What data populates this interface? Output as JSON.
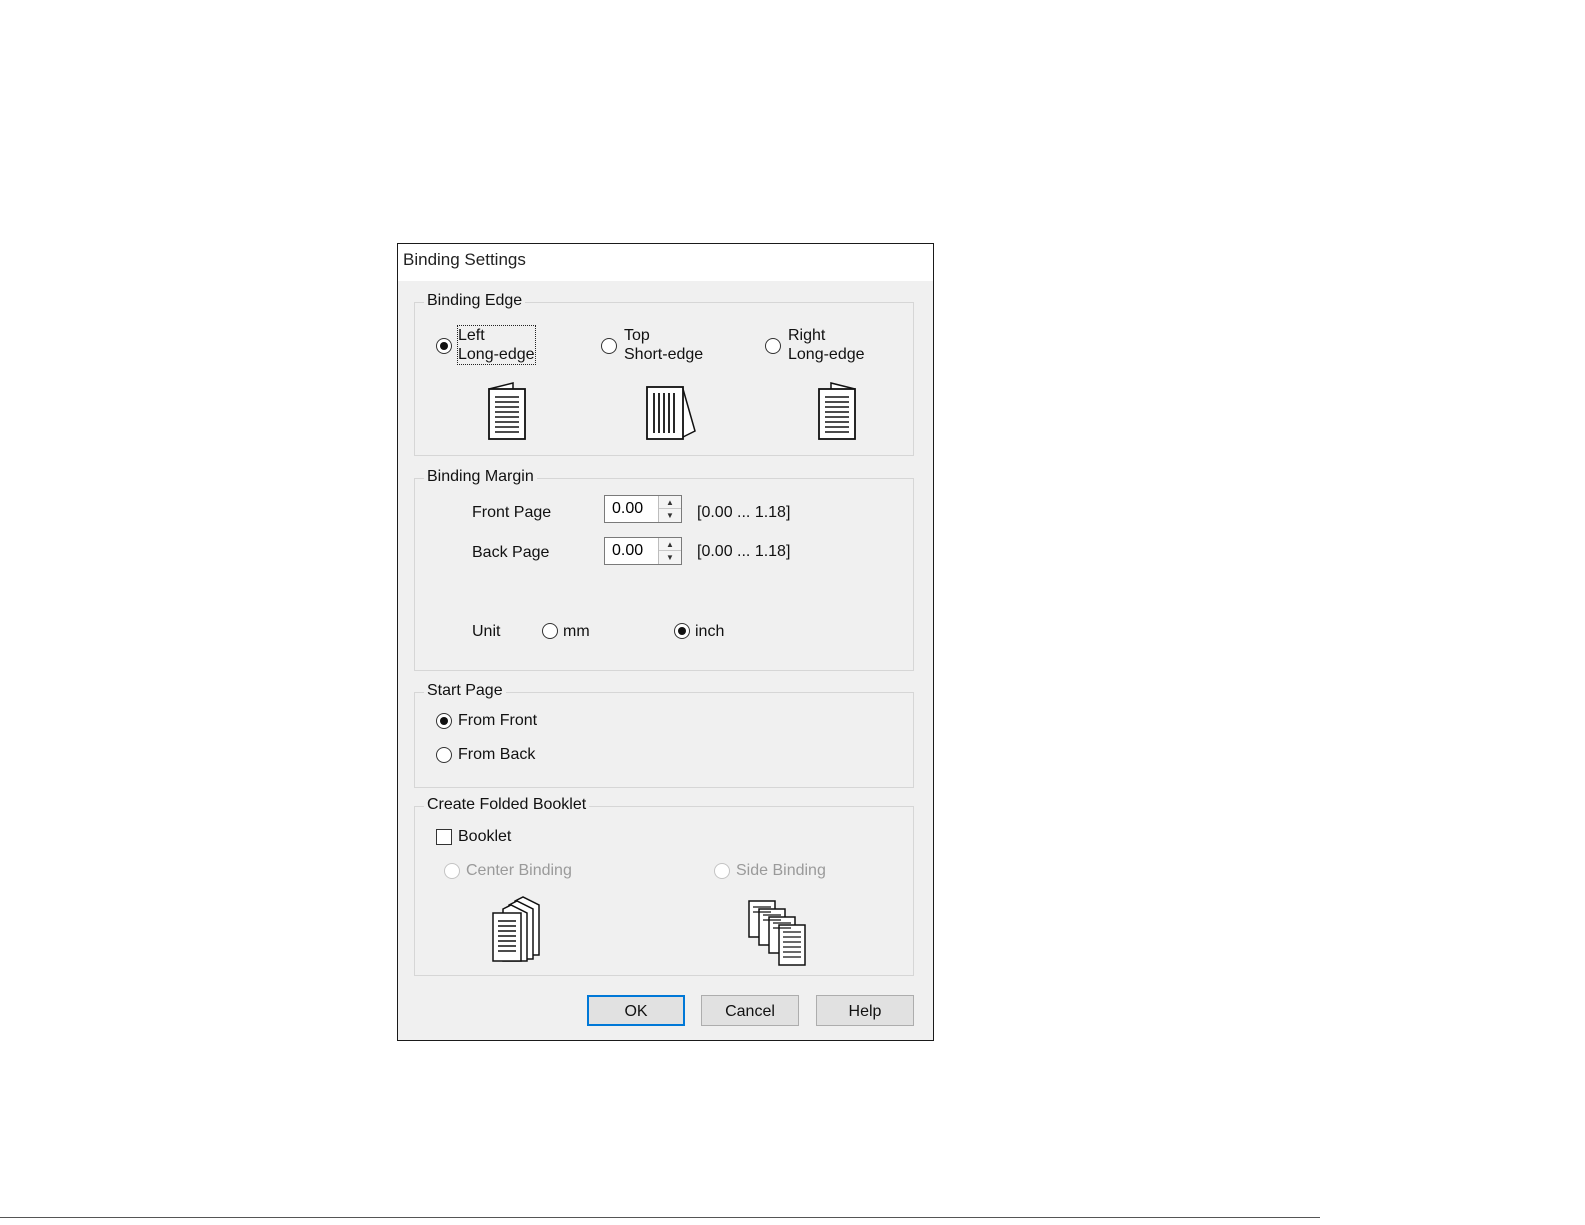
{
  "dialog": {
    "title": "Binding Settings"
  },
  "binding_edge": {
    "legend": "Binding Edge",
    "options": [
      {
        "line1": "Left",
        "line2": "Long-edge",
        "checked": true,
        "icon": "left-binding-page-icon"
      },
      {
        "line1": "Top",
        "line2": "Short-edge",
        "checked": false,
        "icon": "top-binding-page-icon"
      },
      {
        "line1": "Right",
        "line2": "Long-edge",
        "checked": false,
        "icon": "right-binding-page-icon"
      }
    ]
  },
  "binding_margin": {
    "legend": "Binding Margin",
    "front_label": "Front Page",
    "front_value": "0.00",
    "front_range": "[0.00 ... 1.18]",
    "back_label": "Back Page",
    "back_value": "0.00",
    "back_range": "[0.00 ... 1.18]",
    "unit_label": "Unit",
    "unit_mm": "mm",
    "unit_inch": "inch",
    "unit_selected": "inch"
  },
  "start_page": {
    "legend": "Start Page",
    "from_front": "From Front",
    "from_back": "From Back",
    "selected": "from_front"
  },
  "booklet": {
    "legend": "Create Folded Booklet",
    "checkbox_label": "Booklet",
    "checked": false,
    "center_binding": "Center Binding",
    "side_binding": "Side Binding"
  },
  "buttons": {
    "ok": "OK",
    "cancel": "Cancel",
    "help": "Help"
  }
}
